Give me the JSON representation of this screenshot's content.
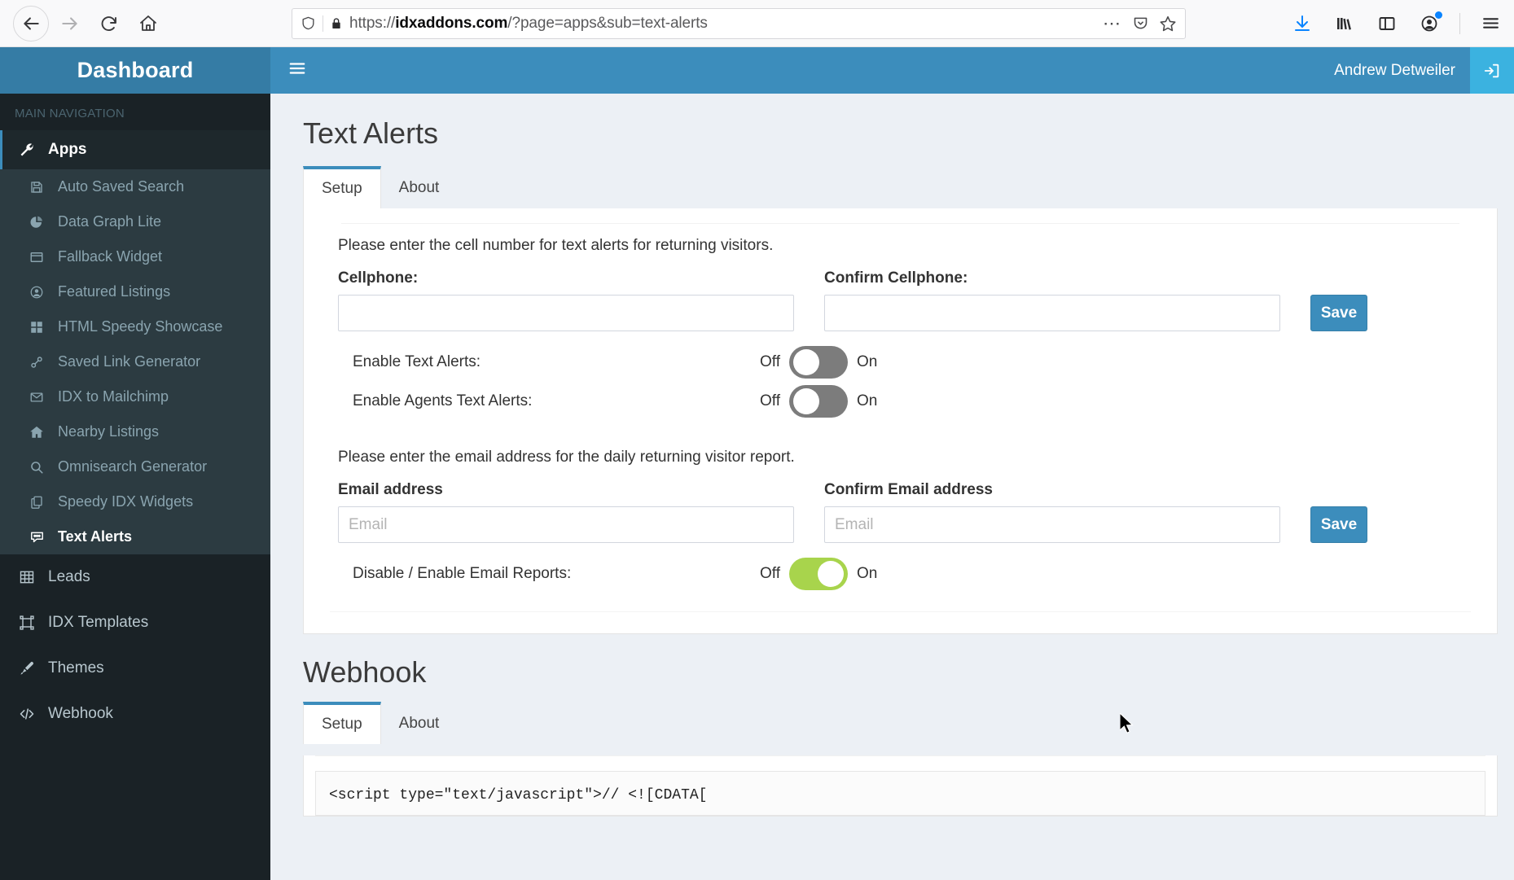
{
  "browser": {
    "back_icon": "arrow-left-icon",
    "forward_icon": "arrow-right-icon",
    "reload_icon": "reload-icon",
    "home_icon": "home-icon",
    "shield_icon": "shield-icon",
    "lock_icon": "padlock-icon",
    "url_scheme": "https://",
    "url_host": "idxaddons.com",
    "url_path": "/?page=apps&sub=text-alerts",
    "url_full": "https://idxaddons.com/?page=apps&sub=text-alerts",
    "page_actions_icon": "ellipsis-icon",
    "pocket_icon": "pocket-icon",
    "bookmark_icon": "star-icon",
    "downloads_icon": "download-icon",
    "library_icon": "library-icon",
    "sidebar_icon": "sidebar-icon",
    "account_icon": "account-icon",
    "menu_icon": "hamburger-menu-icon"
  },
  "sidebar": {
    "logo": "Dashboard",
    "nav_header": "MAIN NAVIGATION",
    "apps": {
      "label": "Apps",
      "icon": "wrench-icon"
    },
    "apps_submenu": [
      {
        "label": "Auto Saved Search",
        "icon": "floppy-disk-icon"
      },
      {
        "label": "Data Graph Lite",
        "icon": "pie-chart-icon"
      },
      {
        "label": "Fallback Widget",
        "icon": "window-icon"
      },
      {
        "label": "Featured Listings",
        "icon": "user-circle-icon"
      },
      {
        "label": "HTML Speedy Showcase",
        "icon": "grid-icon"
      },
      {
        "label": "Saved Link Generator",
        "icon": "link-icon"
      },
      {
        "label": "IDX to Mailchimp",
        "icon": "envelope-icon"
      },
      {
        "label": "Nearby Listings",
        "icon": "home-icon"
      },
      {
        "label": "Omnisearch Generator",
        "icon": "search-icon"
      },
      {
        "label": "Speedy IDX Widgets",
        "icon": "copy-icon"
      },
      {
        "label": "Text Alerts",
        "icon": "comment-icon"
      }
    ],
    "main_items": [
      {
        "label": "Leads",
        "icon": "table-icon"
      },
      {
        "label": "IDX Templates",
        "icon": "template-icon"
      },
      {
        "label": "Themes",
        "icon": "paintbrush-icon"
      },
      {
        "label": "Webhook",
        "icon": "code-icon"
      }
    ]
  },
  "topbar": {
    "toggle_icon": "hamburger-menu-icon",
    "user_name": "Andrew Detweiler",
    "logout_icon": "sign-out-icon"
  },
  "text_alerts": {
    "title": "Text Alerts",
    "tabs": [
      {
        "label": "Setup",
        "active": true
      },
      {
        "label": "About",
        "active": false
      }
    ],
    "cell_lead": "Please enter the cell number for text alerts for returning visitors.",
    "cellphone_label": "Cellphone:",
    "cellphone_value": "",
    "cellphone_placeholder": "",
    "confirm_cellphone_label": "Confirm Cellphone:",
    "confirm_cellphone_value": "",
    "confirm_cellphone_placeholder": "",
    "save_cell_label": "Save",
    "toggle_off_label": "Off",
    "toggle_on_label": "On",
    "enable_text_alerts_label": "Enable Text Alerts:",
    "enable_text_alerts_state": "off",
    "enable_agents_label": "Enable Agents Text Alerts:",
    "enable_agents_state": "off",
    "email_lead": "Please enter the email address for the daily returning visitor report.",
    "email_label": "Email address",
    "email_value": "",
    "email_placeholder": "Email",
    "confirm_email_label": "Confirm Email address",
    "confirm_email_value": "",
    "confirm_email_placeholder": "Email",
    "save_email_label": "Save",
    "email_reports_label": "Disable / Enable Email Reports:",
    "email_reports_state": "on"
  },
  "webhook": {
    "title": "Webhook",
    "tabs": [
      {
        "label": "Setup",
        "active": true
      },
      {
        "label": "About",
        "active": false
      }
    ],
    "code": "<script type=\"text/javascript\">// <![CDATA["
  },
  "colors": {
    "brand_blue": "#3c8dbc",
    "sidebar_dark": "#1a2226",
    "submenu_dark": "#2c3b41",
    "toggle_on_green": "#a8d44c",
    "toggle_off_gray": "#7c7c7c",
    "content_bg": "#ecf0f5",
    "logout_blue": "#3bb2e0"
  }
}
